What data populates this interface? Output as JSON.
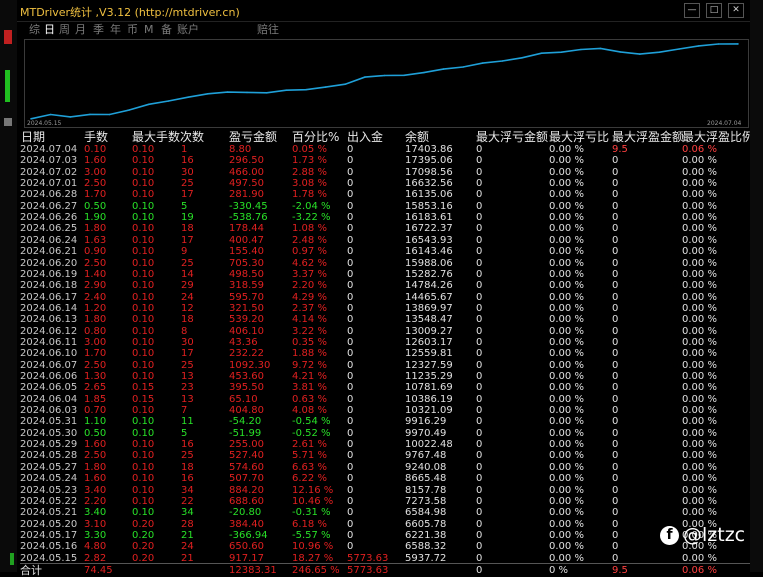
{
  "window": {
    "title": "MTDriver统计 ,V3.12 (http://mtdriver.cn)",
    "controls": [
      "—",
      "□",
      "✕"
    ]
  },
  "tabs": [
    {
      "label": "综",
      "active": false
    },
    {
      "label": "日",
      "active": true
    },
    {
      "label": "周",
      "active": false
    },
    {
      "label": "月",
      "active": false
    },
    {
      "label": "季",
      "active": false
    },
    {
      "label": "年",
      "active": false
    },
    {
      "label": "币",
      "active": false
    },
    {
      "label": "M",
      "active": false
    },
    {
      "label": "备",
      "active": false
    },
    {
      "label": "账户",
      "active": false
    },
    {
      "label": "赔往",
      "active": false
    }
  ],
  "chart": {
    "start_date": "2024.05.15",
    "end_date": "2024.07.04",
    "line_color": "#1fa0d8"
  },
  "chart_data": {
    "type": "line",
    "x": [
      "2024.05.15",
      "2024.05.16",
      "2024.05.17",
      "2024.05.20",
      "2024.05.21",
      "2024.05.22",
      "2024.05.23",
      "2024.05.24",
      "2024.05.27",
      "2024.05.28",
      "2024.05.29",
      "2024.05.30",
      "2024.05.31",
      "2024.06.03",
      "2024.06.04",
      "2024.06.05",
      "2024.06.06",
      "2024.06.07",
      "2024.06.10",
      "2024.06.11",
      "2024.06.12",
      "2024.06.13",
      "2024.06.14",
      "2024.06.17",
      "2024.06.18",
      "2024.06.19",
      "2024.06.20",
      "2024.06.21",
      "2024.06.24",
      "2024.06.25",
      "2024.06.26",
      "2024.06.27",
      "2024.06.28",
      "2024.07.01",
      "2024.07.02",
      "2024.07.03",
      "2024.07.04"
    ],
    "values": [
      5937.72,
      6588.32,
      6221.38,
      6605.78,
      6584.98,
      7273.58,
      8157.78,
      8665.48,
      9240.08,
      9767.48,
      10022.48,
      9970.49,
      9916.29,
      10321.09,
      10386.19,
      10781.69,
      11235.29,
      12327.59,
      12559.81,
      12603.17,
      13009.27,
      13548.47,
      13869.97,
      14465.67,
      14784.26,
      15282.76,
      15988.06,
      16143.46,
      16543.93,
      16722.37,
      16183.61,
      15853.16,
      16135.06,
      16632.56,
      17098.56,
      17395.06,
      17403.86
    ],
    "ylim": [
      5900,
      17700
    ]
  },
  "table": {
    "headers": [
      "日期",
      "手数",
      "最大手数",
      "次数",
      "盈亏金额",
      "百分比%",
      "出入金",
      "余额",
      "最大浮亏金额",
      "最大浮亏比",
      "最大浮盈金额",
      "最大浮盈比例"
    ],
    "rows": [
      [
        "2024.07.04",
        "0.10",
        "0.10",
        "1",
        "8.80",
        "0.05 %",
        "0",
        "17403.86",
        "0",
        "0.00 %",
        "9.5",
        "0.06 %"
      ],
      [
        "2024.07.03",
        "1.60",
        "0.10",
        "16",
        "296.50",
        "1.73 %",
        "0",
        "17395.06",
        "0",
        "0.00 %",
        "0",
        "0.00 %"
      ],
      [
        "2024.07.02",
        "3.00",
        "0.10",
        "30",
        "466.00",
        "2.88 %",
        "0",
        "17098.56",
        "0",
        "0.00 %",
        "0",
        "0.00 %"
      ],
      [
        "2024.07.01",
        "2.50",
        "0.10",
        "25",
        "497.50",
        "3.08 %",
        "0",
        "16632.56",
        "0",
        "0.00 %",
        "0",
        "0.00 %"
      ],
      [
        "2024.06.28",
        "1.70",
        "0.10",
        "17",
        "281.90",
        "1.78 %",
        "0",
        "16135.06",
        "0",
        "0.00 %",
        "0",
        "0.00 %"
      ],
      [
        "2024.06.27",
        "0.50",
        "0.10",
        "5",
        "-330.45",
        "-2.04 %",
        "0",
        "15853.16",
        "0",
        "0.00 %",
        "0",
        "0.00 %"
      ],
      [
        "2024.06.26",
        "1.90",
        "0.10",
        "19",
        "-538.76",
        "-3.22 %",
        "0",
        "16183.61",
        "0",
        "0.00 %",
        "0",
        "0.00 %"
      ],
      [
        "2024.06.25",
        "1.80",
        "0.10",
        "18",
        "178.44",
        "1.08 %",
        "0",
        "16722.37",
        "0",
        "0.00 %",
        "0",
        "0.00 %"
      ],
      [
        "2024.06.24",
        "1.63",
        "0.10",
        "17",
        "400.47",
        "2.48 %",
        "0",
        "16543.93",
        "0",
        "0.00 %",
        "0",
        "0.00 %"
      ],
      [
        "2024.06.21",
        "0.90",
        "0.10",
        "9",
        "155.40",
        "0.97 %",
        "0",
        "16143.46",
        "0",
        "0.00 %",
        "0",
        "0.00 %"
      ],
      [
        "2024.06.20",
        "2.50",
        "0.10",
        "25",
        "705.30",
        "4.62 %",
        "0",
        "15988.06",
        "0",
        "0.00 %",
        "0",
        "0.00 %"
      ],
      [
        "2024.06.19",
        "1.40",
        "0.10",
        "14",
        "498.50",
        "3.37 %",
        "0",
        "15282.76",
        "0",
        "0.00 %",
        "0",
        "0.00 %"
      ],
      [
        "2024.06.18",
        "2.90",
        "0.10",
        "29",
        "318.59",
        "2.20 %",
        "0",
        "14784.26",
        "0",
        "0.00 %",
        "0",
        "0.00 %"
      ],
      [
        "2024.06.17",
        "2.40",
        "0.10",
        "24",
        "595.70",
        "4.29 %",
        "0",
        "14465.67",
        "0",
        "0.00 %",
        "0",
        "0.00 %"
      ],
      [
        "2024.06.14",
        "1.20",
        "0.10",
        "12",
        "321.50",
        "2.37 %",
        "0",
        "13869.97",
        "0",
        "0.00 %",
        "0",
        "0.00 %"
      ],
      [
        "2024.06.13",
        "1.80",
        "0.10",
        "18",
        "539.20",
        "4.14 %",
        "0",
        "13548.47",
        "0",
        "0.00 %",
        "0",
        "0.00 %"
      ],
      [
        "2024.06.12",
        "0.80",
        "0.10",
        "8",
        "406.10",
        "3.22 %",
        "0",
        "13009.27",
        "0",
        "0.00 %",
        "0",
        "0.00 %"
      ],
      [
        "2024.06.11",
        "3.00",
        "0.10",
        "30",
        "43.36",
        "0.35 %",
        "0",
        "12603.17",
        "0",
        "0.00 %",
        "0",
        "0.00 %"
      ],
      [
        "2024.06.10",
        "1.70",
        "0.10",
        "17",
        "232.22",
        "1.88 %",
        "0",
        "12559.81",
        "0",
        "0.00 %",
        "0",
        "0.00 %"
      ],
      [
        "2024.06.07",
        "2.50",
        "0.10",
        "25",
        "1092.30",
        "9.72 %",
        "0",
        "12327.59",
        "0",
        "0.00 %",
        "0",
        "0.00 %"
      ],
      [
        "2024.06.06",
        "1.30",
        "0.10",
        "13",
        "453.60",
        "4.21 %",
        "0",
        "11235.29",
        "0",
        "0.00 %",
        "0",
        "0.00 %"
      ],
      [
        "2024.06.05",
        "2.65",
        "0.15",
        "23",
        "395.50",
        "3.81 %",
        "0",
        "10781.69",
        "0",
        "0.00 %",
        "0",
        "0.00 %"
      ],
      [
        "2024.06.04",
        "1.85",
        "0.15",
        "13",
        "65.10",
        "0.63 %",
        "0",
        "10386.19",
        "0",
        "0.00 %",
        "0",
        "0.00 %"
      ],
      [
        "2024.06.03",
        "0.70",
        "0.10",
        "7",
        "404.80",
        "4.08 %",
        "0",
        "10321.09",
        "0",
        "0.00 %",
        "0",
        "0.00 %"
      ],
      [
        "2024.05.31",
        "1.10",
        "0.10",
        "11",
        "-54.20",
        "-0.54 %",
        "0",
        "9916.29",
        "0",
        "0.00 %",
        "0",
        "0.00 %"
      ],
      [
        "2024.05.30",
        "0.50",
        "0.10",
        "5",
        "-51.99",
        "-0.52 %",
        "0",
        "9970.49",
        "0",
        "0.00 %",
        "0",
        "0.00 %"
      ],
      [
        "2024.05.29",
        "1.60",
        "0.10",
        "16",
        "255.00",
        "2.61 %",
        "0",
        "10022.48",
        "0",
        "0.00 %",
        "0",
        "0.00 %"
      ],
      [
        "2024.05.28",
        "2.50",
        "0.10",
        "25",
        "527.40",
        "5.71 %",
        "0",
        "9767.48",
        "0",
        "0.00 %",
        "0",
        "0.00 %"
      ],
      [
        "2024.05.27",
        "1.80",
        "0.10",
        "18",
        "574.60",
        "6.63 %",
        "0",
        "9240.08",
        "0",
        "0.00 %",
        "0",
        "0.00 %"
      ],
      [
        "2024.05.24",
        "1.60",
        "0.10",
        "16",
        "507.70",
        "6.22 %",
        "0",
        "8665.48",
        "0",
        "0.00 %",
        "0",
        "0.00 %"
      ],
      [
        "2024.05.23",
        "3.40",
        "0.10",
        "34",
        "884.20",
        "12.16 %",
        "0",
        "8157.78",
        "0",
        "0.00 %",
        "0",
        "0.00 %"
      ],
      [
        "2024.05.22",
        "2.20",
        "0.10",
        "22",
        "688.60",
        "10.46 %",
        "0",
        "7273.58",
        "0",
        "0.00 %",
        "0",
        "0.00 %"
      ],
      [
        "2024.05.21",
        "3.40",
        "0.10",
        "34",
        "-20.80",
        "-0.31 %",
        "0",
        "6584.98",
        "0",
        "0.00 %",
        "0",
        "0.00 %"
      ],
      [
        "2024.05.20",
        "3.10",
        "0.20",
        "28",
        "384.40",
        "6.18 %",
        "0",
        "6605.78",
        "0",
        "0.00 %",
        "0",
        "0.00 %"
      ],
      [
        "2024.05.17",
        "3.30",
        "0.20",
        "21",
        "-366.94",
        "-5.57 %",
        "0",
        "6221.38",
        "0",
        "0.00 %",
        "0",
        "0.00 %"
      ],
      [
        "2024.05.16",
        "4.80",
        "0.20",
        "24",
        "650.60",
        "10.96 %",
        "0",
        "6588.32",
        "0",
        "0.00 %",
        "0",
        "0.00 %"
      ],
      [
        "2024.05.15",
        "2.82",
        "0.20",
        "21",
        "917.17",
        "18.27 %",
        "5773.63",
        "5937.72",
        "0",
        "0.00 %",
        "0",
        "0.00 %"
      ]
    ],
    "total": [
      "合计",
      "74.45",
      "",
      "",
      "12383.31",
      "246.65 %",
      "5773.63",
      "",
      "0",
      "0 %",
      "9.5",
      "0.06 %"
    ]
  },
  "watermark": {
    "brand_glyph": "f",
    "handle": "@lztzc"
  }
}
